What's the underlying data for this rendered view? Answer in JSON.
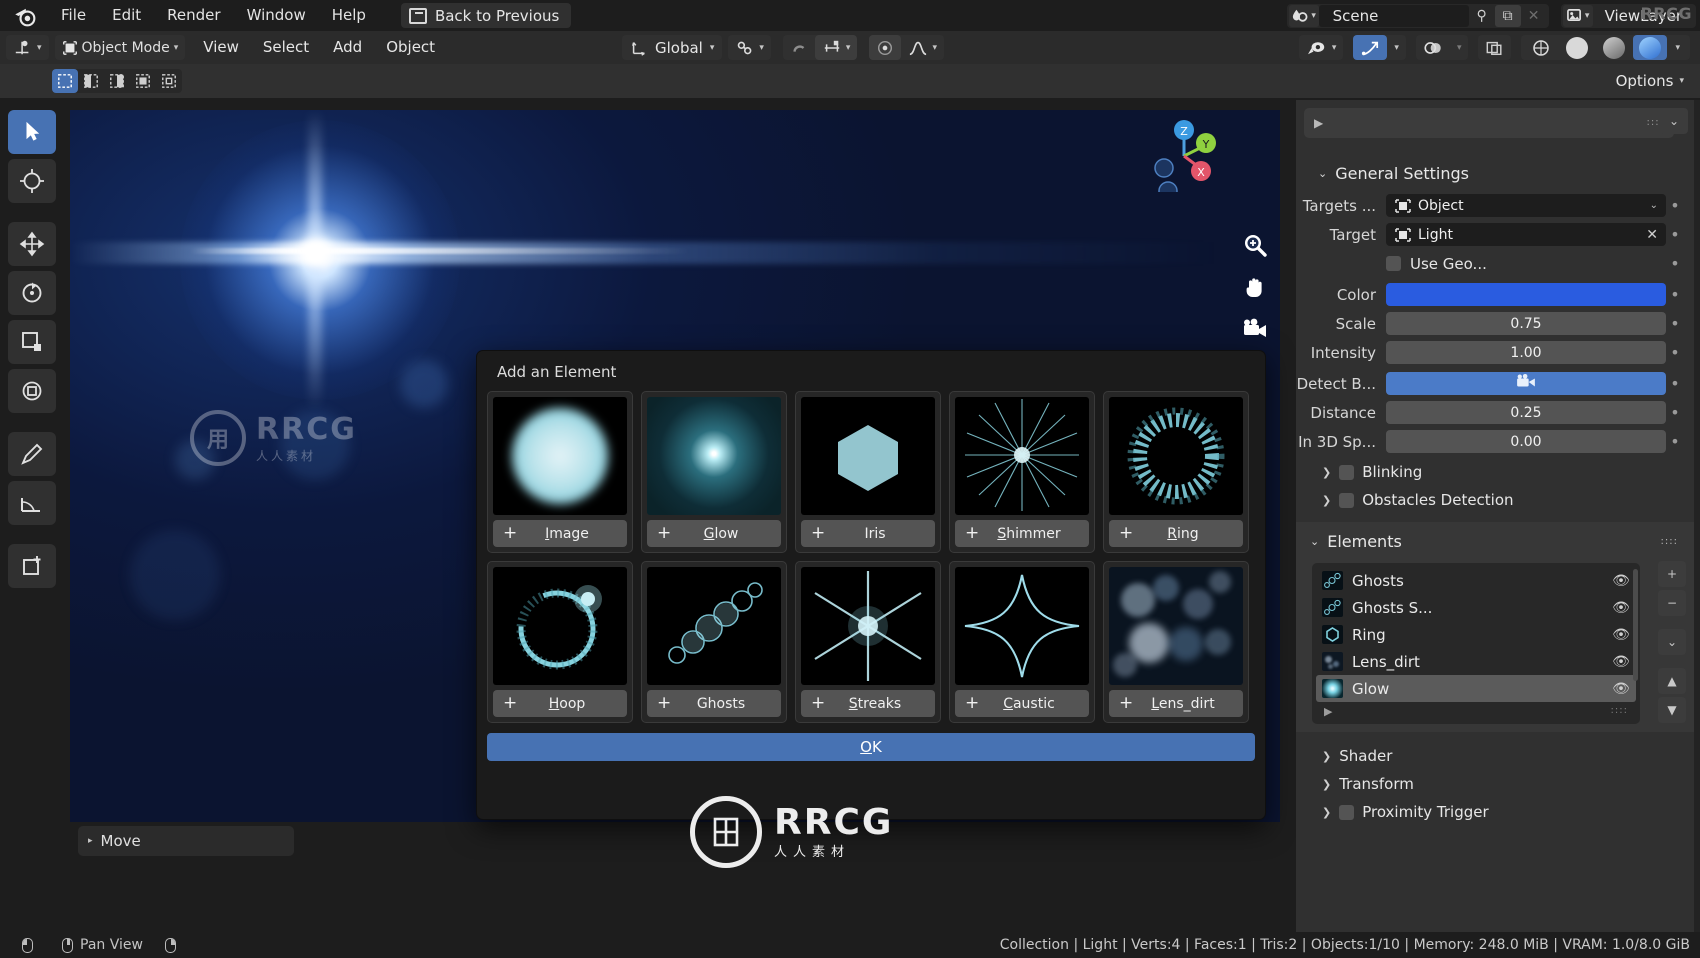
{
  "topbar": {
    "logo_icon": "blender-logo-icon",
    "menus": [
      "File",
      "Edit",
      "Render",
      "Window",
      "Help"
    ],
    "back_button": {
      "label": "Back to Previous",
      "icon": "screen-back-icon"
    },
    "scene": {
      "icon": "scene-icon",
      "name": "Scene",
      "pin_icon": "pin-icon",
      "copy_icon": "duplicate-icon",
      "close_icon": "close-icon"
    },
    "viewlayer": {
      "icon": "viewlayer-icon",
      "name": "ViewLayer"
    },
    "watermark": "RRCG"
  },
  "header": {
    "editor_type_icon": "editor-type-icon",
    "mode": {
      "label": "Object Mode",
      "icon": "object-mode-icon"
    },
    "menus": [
      "View",
      "Select",
      "Add",
      "Object"
    ],
    "orientation": {
      "label": "Global",
      "icon": "transform-orientation-icon"
    },
    "snap_icon": "snap-magnet-icon",
    "proportional_icon": "proportional-edit-icon",
    "proportional_falloff_icon": "falloff-curve-icon",
    "pivot_icon": "pivot-point-icon",
    "snap_target_icon": "snap-increment-icon",
    "visibility_icon": "show-gizmo-icon",
    "gizmo_icon": "gizmo-icon",
    "overlays_icon": "overlays-icon",
    "xray_icon": "xray-icon",
    "shading": [
      "wireframe",
      "solid",
      "material-preview",
      "rendered"
    ]
  },
  "toolrow": {
    "select_modes": [
      "tweak",
      "box-select",
      "circle-select",
      "lasso-select"
    ],
    "active_select_mode": 0,
    "options_label": "Options"
  },
  "left_toolbar": {
    "tools": [
      {
        "name": "tweak-select-tool",
        "active": true
      },
      {
        "name": "cursor-tool",
        "active": false
      },
      {
        "name": "move-tool",
        "active": false
      },
      {
        "name": "rotate-tool",
        "active": false
      },
      {
        "name": "scale-tool",
        "active": false
      },
      {
        "name": "transform-tool",
        "active": false
      },
      {
        "name": "annotate-tool",
        "active": false
      },
      {
        "name": "measure-tool",
        "active": false
      },
      {
        "name": "add-cube-tool",
        "active": false
      }
    ]
  },
  "viewport": {
    "gizmo_axes": [
      "Z",
      "Y",
      "X"
    ],
    "nav_icons": [
      "zoom-icon",
      "pan-hand-icon",
      "camera-icon"
    ],
    "operator_panel": {
      "label": "Move",
      "icon": "chevron-right-icon"
    },
    "watermark_text": "RRCG",
    "watermark_sub": "人人素材"
  },
  "dialog": {
    "title": "Add an Element",
    "ok_label": "OK",
    "ok_accel": "O",
    "items": [
      {
        "label": "Image",
        "accel": "I",
        "thumb": "image-element-thumb",
        "plus": "+"
      },
      {
        "label": "Glow",
        "accel": "G",
        "thumb": "glow-element-thumb",
        "plus": "+"
      },
      {
        "label": "Iris",
        "accel": "",
        "thumb": "iris-element-thumb",
        "plus": "+"
      },
      {
        "label": "Shimmer",
        "accel": "S",
        "thumb": "shimmer-element-thumb",
        "plus": "+"
      },
      {
        "label": "Ring",
        "accel": "R",
        "thumb": "ring-element-thumb",
        "plus": "+"
      },
      {
        "label": "Hoop",
        "accel": "H",
        "thumb": "hoop-element-thumb",
        "plus": "+"
      },
      {
        "label": "Ghosts",
        "accel": "G",
        "thumb": "ghosts-element-thumb",
        "plus": "+"
      },
      {
        "label": "Streaks",
        "accel": "S",
        "thumb": "streaks-element-thumb",
        "plus": "+"
      },
      {
        "label": "Caustic",
        "accel": "C",
        "thumb": "caustic-element-thumb",
        "plus": "+"
      },
      {
        "label": "Lens_dirt",
        "accel": "L",
        "thumb": "lensdirt-element-thumb",
        "plus": "+"
      }
    ]
  },
  "properties": {
    "top_button_arrow": "play-icon",
    "general": {
      "title": "General Settings",
      "rows": [
        {
          "label": "Targets ...",
          "value": "Object",
          "type": "object-picker",
          "dot": true
        },
        {
          "label": "Target",
          "value": "Light",
          "type": "object-picker",
          "dot": true,
          "clearable": true
        },
        {
          "label": "",
          "value": "Use Geo...",
          "type": "checkbox",
          "dot": true
        },
        {
          "label": "Color",
          "value": "",
          "type": "color",
          "color": "#2a5ce0",
          "dot": true
        },
        {
          "label": "Scale",
          "value": "0.75",
          "type": "number",
          "dot": true
        },
        {
          "label": "Intensity",
          "value": "1.00",
          "type": "number",
          "dot": true
        },
        {
          "label": "Detect B...",
          "value": "",
          "type": "toggle-on",
          "icon": "camera-detect-icon",
          "dot": true
        },
        {
          "label": "Distance",
          "value": "0.25",
          "type": "number",
          "dot": true
        },
        {
          "label": "In 3D Sp...",
          "value": "0.00",
          "type": "number",
          "dot": true
        }
      ],
      "subpanels": [
        {
          "label": "Blinking",
          "checked": false
        },
        {
          "label": "Obstacles Detection",
          "checked": false
        }
      ]
    },
    "elements": {
      "title": "Elements",
      "items": [
        {
          "name": "Ghosts",
          "thumb": "ghosts-thumb",
          "visible": true,
          "active": false
        },
        {
          "name": "Ghosts S...",
          "thumb": "ghosts-thumb",
          "visible": true,
          "active": false
        },
        {
          "name": "Ring",
          "thumb": "ring-thumb",
          "visible": true,
          "active": false
        },
        {
          "name": "Lens_dirt",
          "thumb": "lensdirt-thumb",
          "visible": true,
          "active": false
        },
        {
          "name": "Glow",
          "thumb": "glow-thumb",
          "visible": true,
          "active": true
        }
      ],
      "side_buttons": [
        "add-element-button",
        "remove-element-button",
        "element-menu-button",
        "move-up-button",
        "move-down-button"
      ]
    },
    "bottom_panels": [
      {
        "label": "Shader",
        "checkbox": false
      },
      {
        "label": "Transform",
        "checkbox": false
      },
      {
        "label": "Proximity Trigger",
        "checkbox": true
      }
    ]
  },
  "statusbar": {
    "left_items": [
      {
        "icon": "mouse-left-icon",
        "label": ""
      },
      {
        "icon": "mouse-middle-icon",
        "label": "Pan View"
      },
      {
        "icon": "mouse-right-icon",
        "label": ""
      }
    ],
    "stats": "Collection | Light | Verts:4 | Faces:1 | Tris:2 | Objects:1/10 | Memory: 248.0 MiB | VRAM: 1.0/8.0 GiB"
  }
}
